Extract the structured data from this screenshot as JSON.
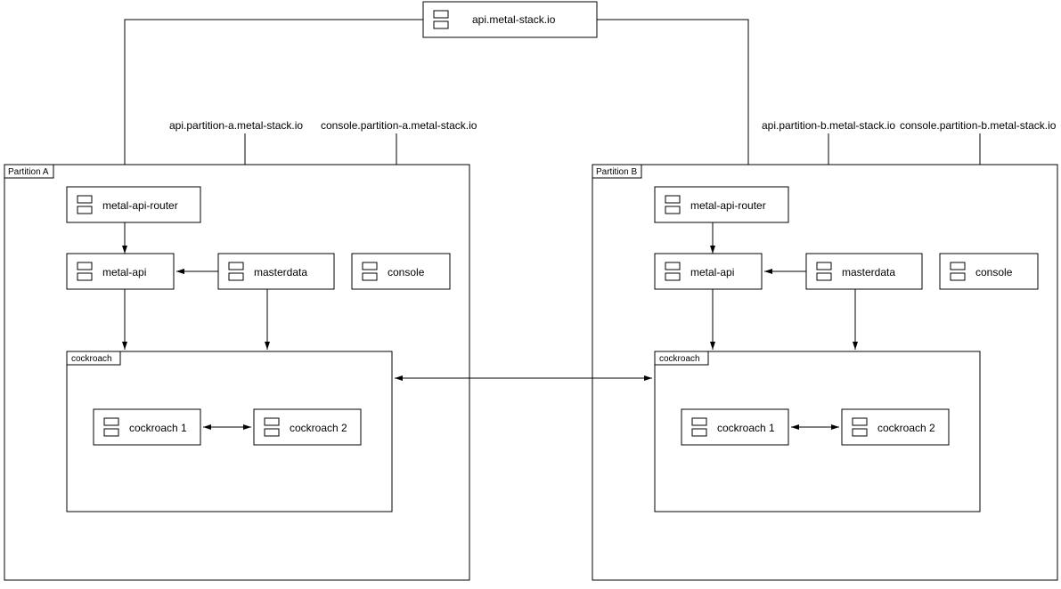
{
  "top_api": "api.metal-stack.io",
  "labels_a": {
    "api": "api.partition-a.metal-stack.io",
    "console": "console.partition-a.metal-stack.io"
  },
  "labels_b": {
    "api": "api.partition-b.metal-stack.io",
    "console": "console.partition-b.metal-stack.io"
  },
  "partition_a": {
    "title": "Partition A",
    "router": "metal-api-router",
    "api": "metal-api",
    "master": "masterdata",
    "console": "console",
    "db_frame": "cockroach",
    "db1": "cockroach 1",
    "db2": "cockroach 2"
  },
  "partition_b": {
    "title": "Partition B",
    "router": "metal-api-router",
    "api": "metal-api",
    "master": "masterdata",
    "console": "console",
    "db_frame": "cockroach",
    "db1": "cockroach 1",
    "db2": "cockroach 2"
  }
}
